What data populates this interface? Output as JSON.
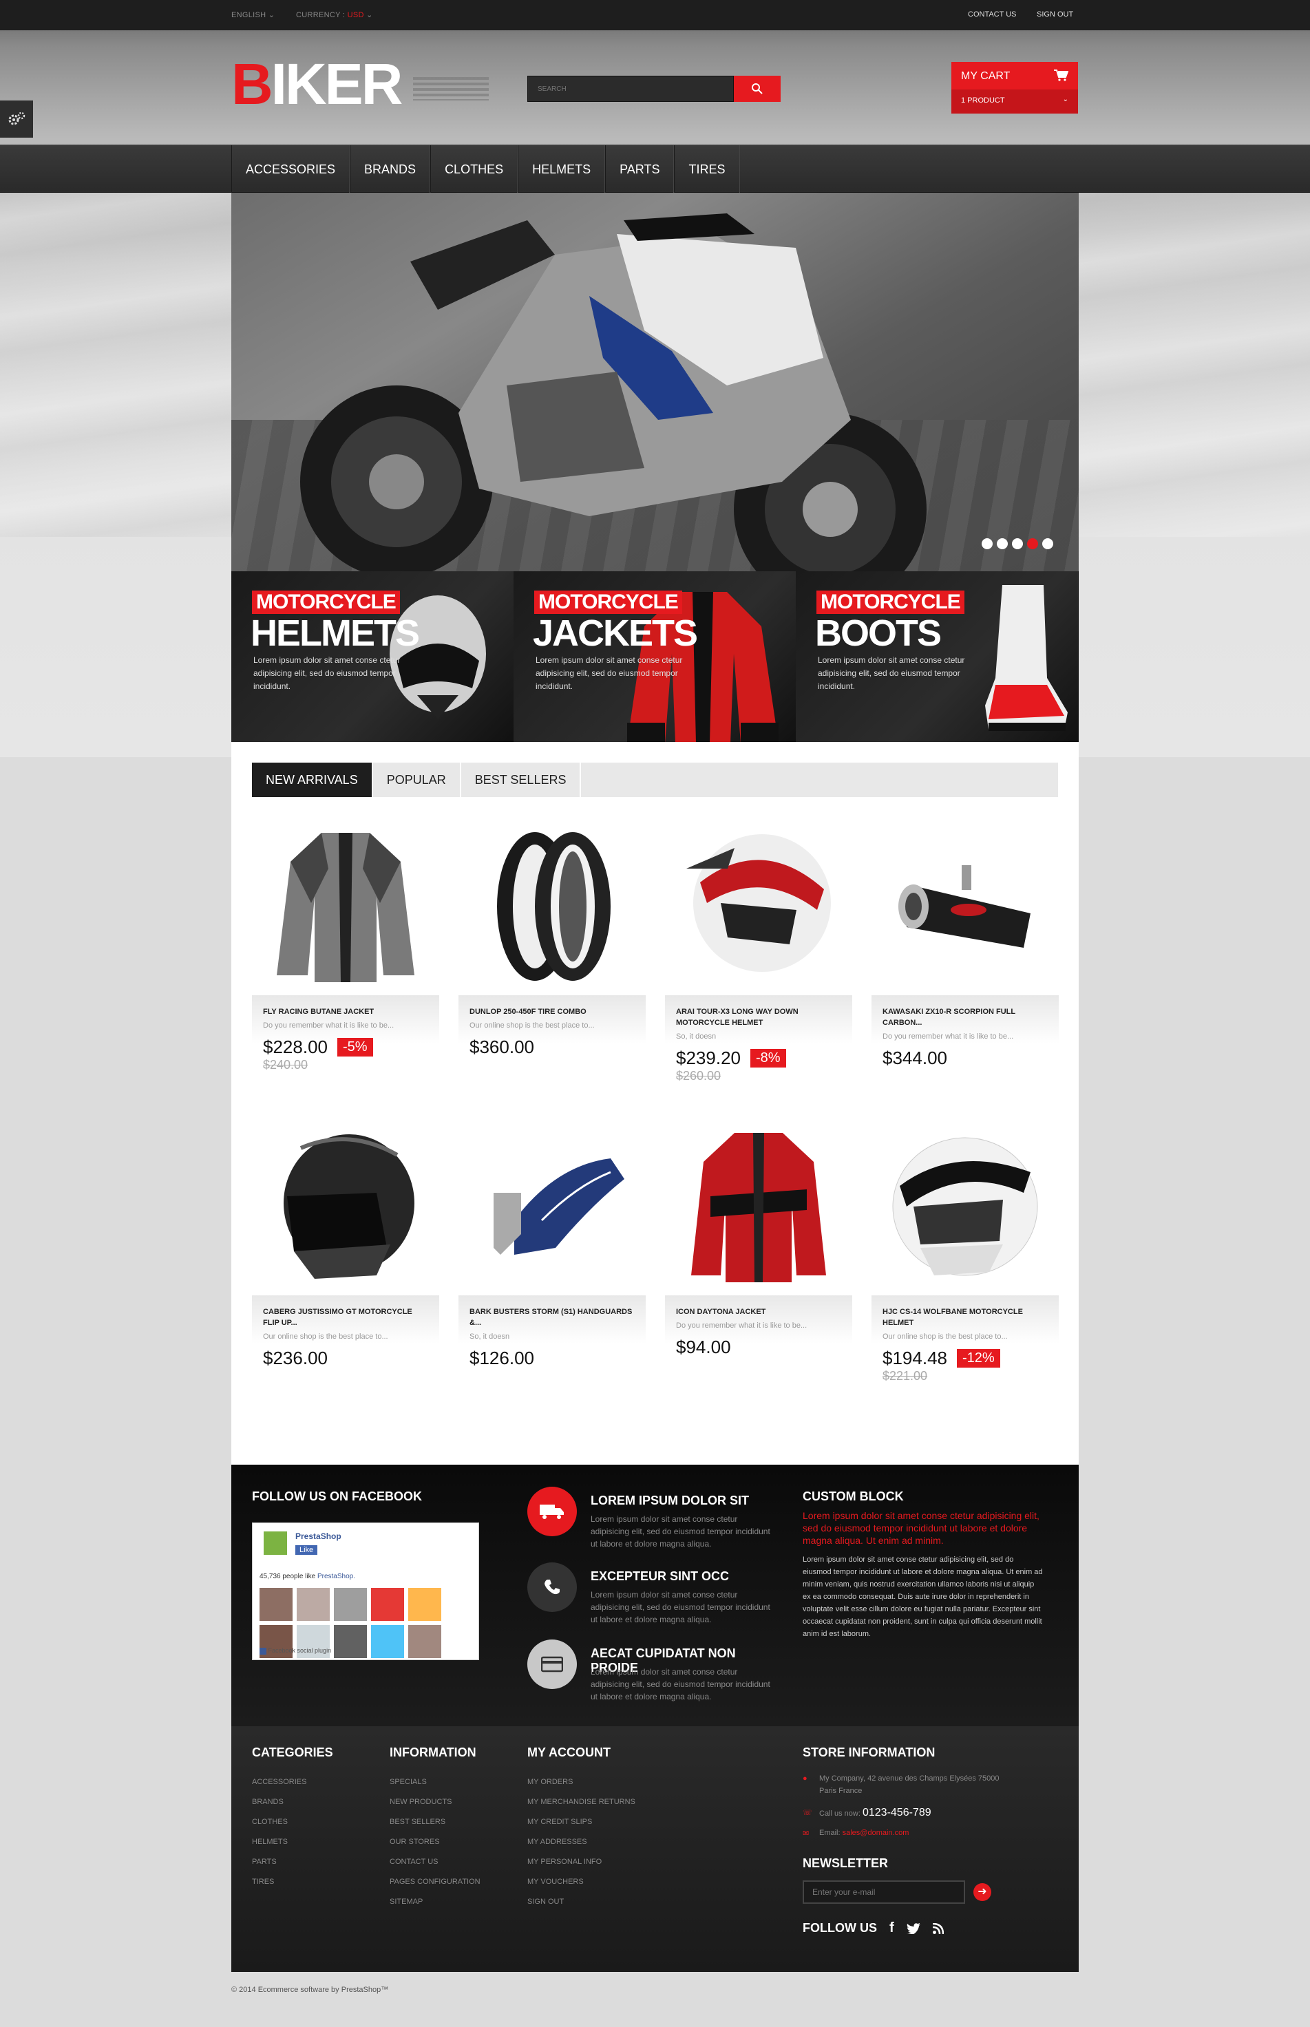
{
  "topbar": {
    "language": "ENGLISH",
    "currency_label": "CURRENCY :",
    "currency_value": "USD",
    "contact": "CONTACT US",
    "signout": "SIGN OUT"
  },
  "header": {
    "logo_accent": "B",
    "logo_rest": "IKER",
    "search_placeholder": "SEARCH",
    "cart_title": "MY CART",
    "cart_count": "1 PRODUCT"
  },
  "nav": [
    "ACCESSORIES",
    "BRANDS",
    "CLOTHES",
    "HELMETS",
    "PARTS",
    "TIRES"
  ],
  "banners": [
    {
      "kicker": "MOTORCYCLE",
      "title": "HELMETS",
      "text": "Lorem ipsum dolor sit amet conse ctetur adipisicing elit, sed do eiusmod tempor incididunt."
    },
    {
      "kicker": "MOTORCYCLE",
      "title": "JACKETS",
      "text": "Lorem ipsum dolor sit amet conse ctetur adipisicing elit, sed do eiusmod tempor incididunt."
    },
    {
      "kicker": "MOTORCYCLE",
      "title": "BOOTS",
      "text": "Lorem ipsum dolor sit amet conse ctetur adipisicing elit, sed do eiusmod tempor incididunt."
    }
  ],
  "tabs": [
    "NEW ARRIVALS",
    "POPULAR",
    "BEST SELLERS"
  ],
  "products": [
    {
      "name": "FLY RACING BUTANE JACKET",
      "desc": "Do you remember what it is like to be...",
      "price": "$228.00",
      "reduction": "-5%",
      "old": "$240.00",
      "icon": "jacket-gray"
    },
    {
      "name": "DUNLOP 250-450F TIRE COMBO",
      "desc": "Our online shop is the best place to...",
      "price": "$360.00",
      "reduction": "",
      "old": "",
      "icon": "tires"
    },
    {
      "name": "ARAI TOUR-X3 LONG WAY DOWN MOTORCYCLE HELMET",
      "desc": "So, it doesn",
      "price": "$239.20",
      "reduction": "-8%",
      "old": "$260.00",
      "icon": "helmet-cross"
    },
    {
      "name": "KAWASAKI ZX10-R SCORPION FULL CARBON...",
      "desc": "Do you remember what it is like to be...",
      "price": "$344.00",
      "reduction": "",
      "old": "",
      "icon": "exhaust"
    },
    {
      "name": "CABERG JUSTISSIMO GT MOTORCYCLE FLIP UP...",
      "desc": "Our online shop is the best place to...",
      "price": "$236.00",
      "reduction": "",
      "old": "",
      "icon": "helmet-black"
    },
    {
      "name": "BARK BUSTERS STORM (S1) HANDGUARDS &...",
      "desc": "So, it doesn",
      "price": "$126.00",
      "reduction": "",
      "old": "",
      "icon": "handguard"
    },
    {
      "name": "ICON DAYTONA JACKET",
      "desc": "Do you remember what it is like to be...",
      "price": "$94.00",
      "reduction": "",
      "old": "",
      "icon": "jacket-red"
    },
    {
      "name": "HJC CS-14 WOLFBANE MOTORCYCLE HELMET",
      "desc": "Our online shop is the best place to...",
      "price": "$194.48",
      "reduction": "-12%",
      "old": "$221.00",
      "icon": "helmet-white"
    }
  ],
  "facebook": {
    "title": "FOLLOW US ON FACEBOOK",
    "page": "PrestaShop",
    "like": "Like",
    "count_text": "45,736 people like",
    "count_link": "PrestaShop.",
    "plugin": "Facebook social plugin"
  },
  "features": [
    {
      "title": "LOREM IPSUM DOLOR SIT",
      "text": "Lorem ipsum dolor sit amet conse ctetur adipisicing elit, sed do eiusmod tempor incididunt ut labore et dolore magna aliqua.",
      "icon": "truck-icon"
    },
    {
      "title": "EXCEPTEUR SINT OCC",
      "text": "Lorem ipsum dolor sit amet conse ctetur adipisicing elit, sed do eiusmod tempor incididunt ut labore et dolore magna aliqua.",
      "icon": "phone-icon"
    },
    {
      "title": "AECAT CUPIDATAT NON PROIDE",
      "text": "Lorem ipsum dolor sit amet conse ctetur adipisicing elit, sed do eiusmod tempor incididunt ut labore et dolore magna aliqua.",
      "icon": "card-icon"
    }
  ],
  "custom": {
    "title": "CUSTOM BLOCK",
    "lead": "Lorem ipsum dolor sit amet conse ctetur adipisicing elit, sed do eiusmod tempor incididunt ut labore et dolore magna aliqua. Ut enim ad minim.",
    "body": "Lorem ipsum dolor sit amet conse ctetur adipisicing elit, sed do eiusmod tempor incididunt ut labore et dolore magna aliqua. Ut enim ad minim veniam, quis nostrud exercitation ullamco laboris nisi ut aliquip ex ea commodo consequat. Duis aute irure dolor in reprehenderit in voluptate velit esse cillum dolore eu fugiat nulla pariatur. Excepteur sint occaecat cupidatat non proident, sunt in culpa qui officia deserunt mollit anim id est laborum."
  },
  "footer": {
    "categories": {
      "title": "CATEGORIES",
      "items": [
        "ACCESSORIES",
        "BRANDS",
        "CLOTHES",
        "HELMETS",
        "PARTS",
        "TIRES"
      ]
    },
    "information": {
      "title": "INFORMATION",
      "items": [
        "SPECIALS",
        "NEW PRODUCTS",
        "BEST SELLERS",
        "OUR STORES",
        "CONTACT US",
        "PAGES CONFIGURATION",
        "SITEMAP"
      ]
    },
    "account": {
      "title": "MY ACCOUNT",
      "items": [
        "MY ORDERS",
        "MY MERCHANDISE RETURNS",
        "MY CREDIT SLIPS",
        "MY ADDRESSES",
        "MY PERSONAL INFO",
        "MY VOUCHERS",
        "SIGN OUT"
      ]
    },
    "store": {
      "title": "STORE INFORMATION",
      "address": "My Company, 42 avenue des Champs Elysées 75000 Paris France",
      "call_label": "Call us now:",
      "phone": "0123-456-789",
      "email_label": "Email:",
      "email": "sales@domain.com"
    },
    "newsletter": {
      "title": "NEWSLETTER",
      "placeholder": "Enter your e-mail"
    },
    "follow": "FOLLOW US"
  },
  "copyright": "© 2014 Ecommerce software by PrestaShop™"
}
